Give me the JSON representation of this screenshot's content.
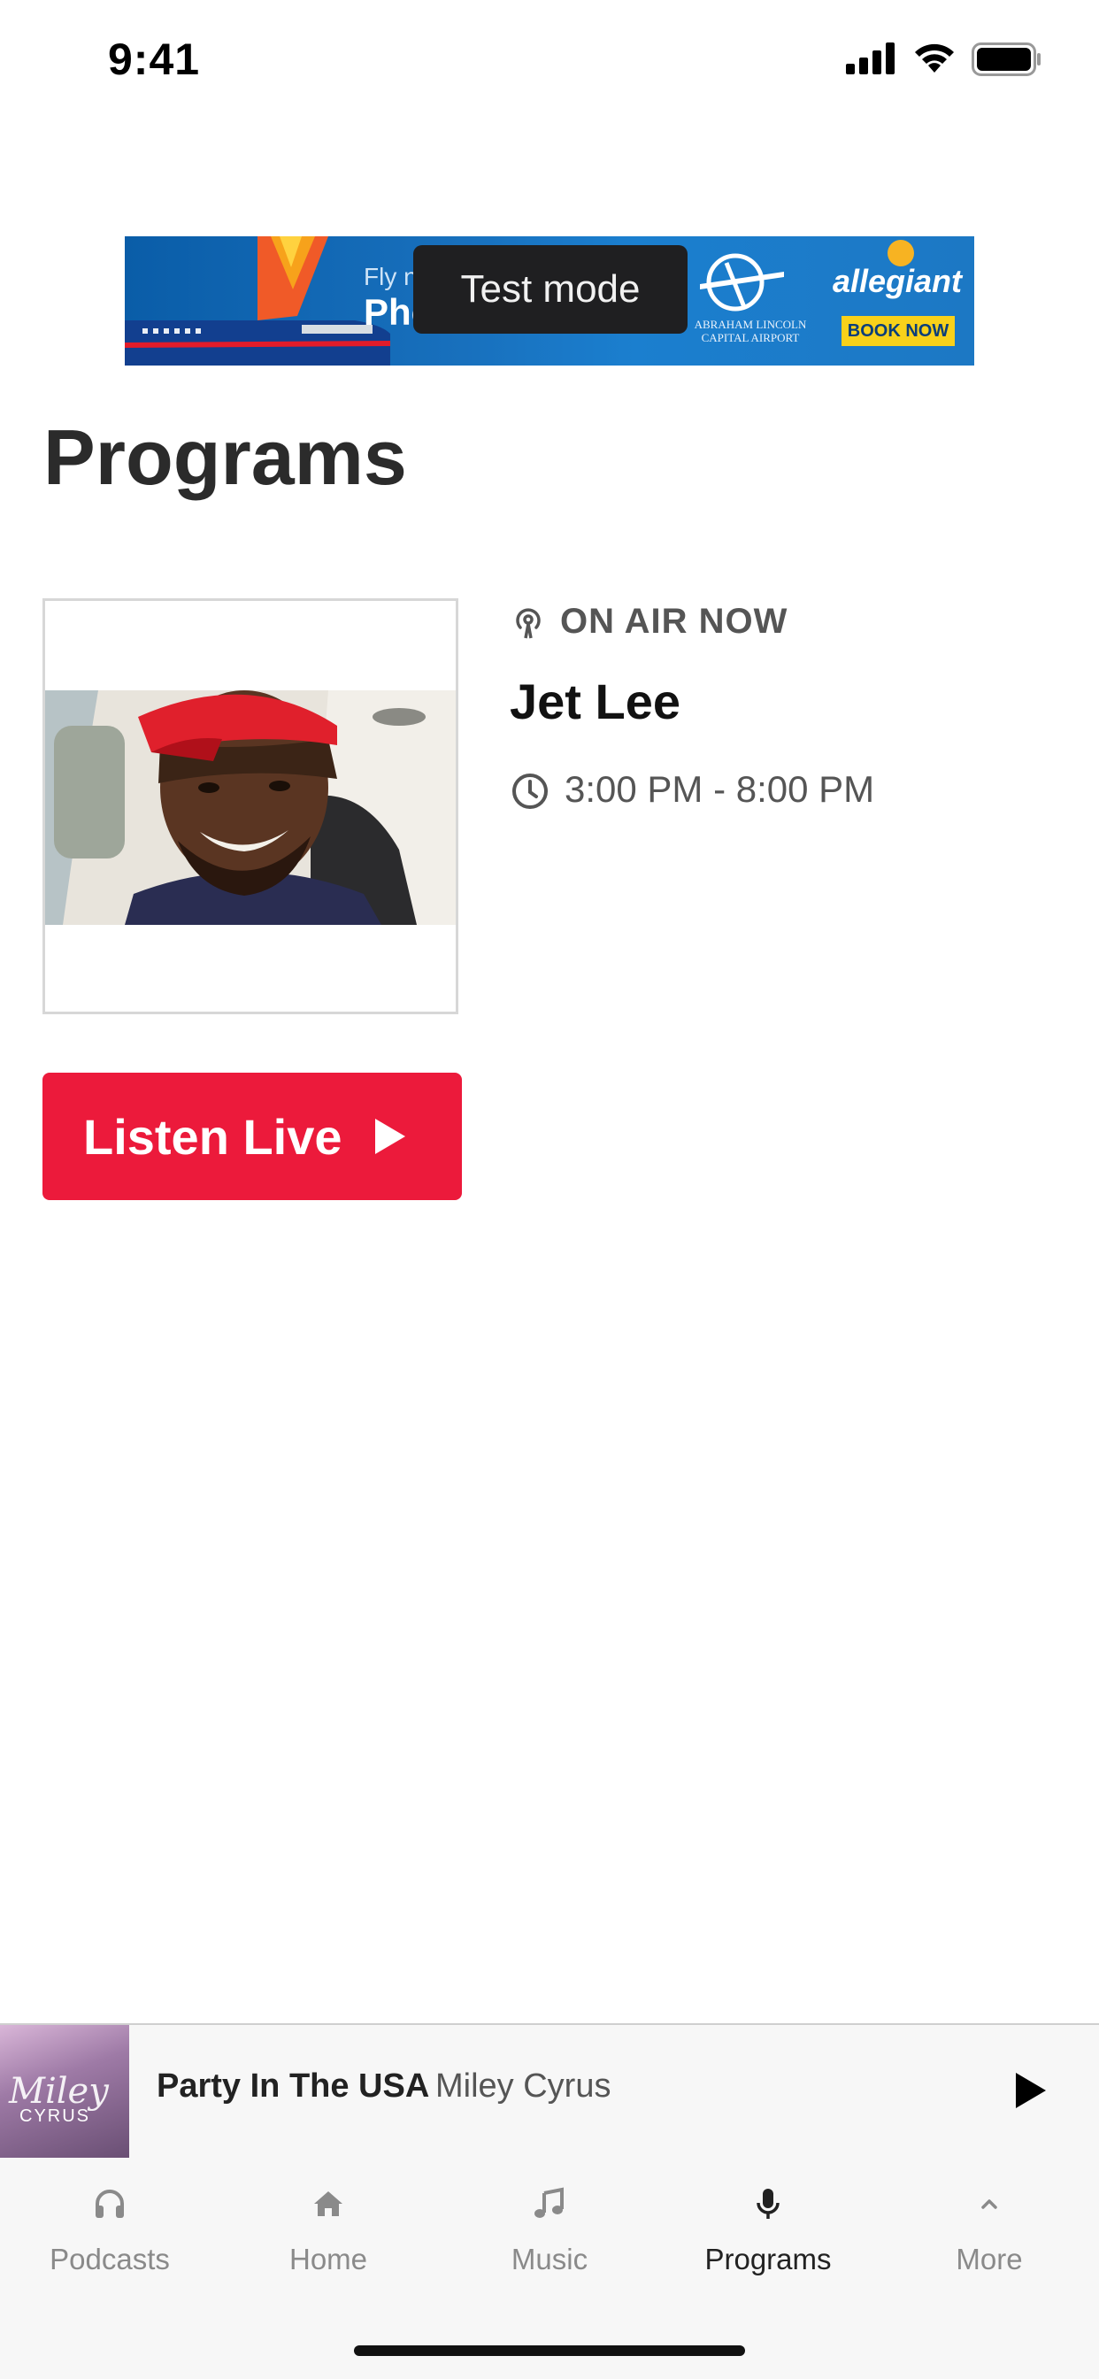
{
  "status_bar": {
    "time": "9:41"
  },
  "ad": {
    "fly_text": "Fly n",
    "headline": "Pho",
    "airport": "ABRAHAM LINCOLN CAPITAL AIRPORT",
    "brand": "allegiant",
    "cta": "BOOK NOW",
    "test_mode": "Test mode"
  },
  "page": {
    "title": "Programs"
  },
  "program": {
    "status": "ON AIR NOW",
    "host": "Jet Lee",
    "time": "3:00 PM - 8:00 PM",
    "listen_label": "Listen Live"
  },
  "now_playing": {
    "song": "Party In The USA",
    "artist": "Miley Cyrus",
    "album_text_1": "Miley",
    "album_text_2": "CYRUS"
  },
  "tabs": [
    {
      "label": "Podcasts",
      "icon": "headphones-icon",
      "active": false
    },
    {
      "label": "Home",
      "icon": "home-icon",
      "active": false
    },
    {
      "label": "Music",
      "icon": "music-note-icon",
      "active": false
    },
    {
      "label": "Programs",
      "icon": "microphone-icon",
      "active": true
    },
    {
      "label": "More",
      "icon": "chevron-up-icon",
      "active": false
    }
  ],
  "colors": {
    "accent": "#ec1a3b",
    "tab_active": "#222222",
    "tab_inactive": "#8a8a8a"
  }
}
